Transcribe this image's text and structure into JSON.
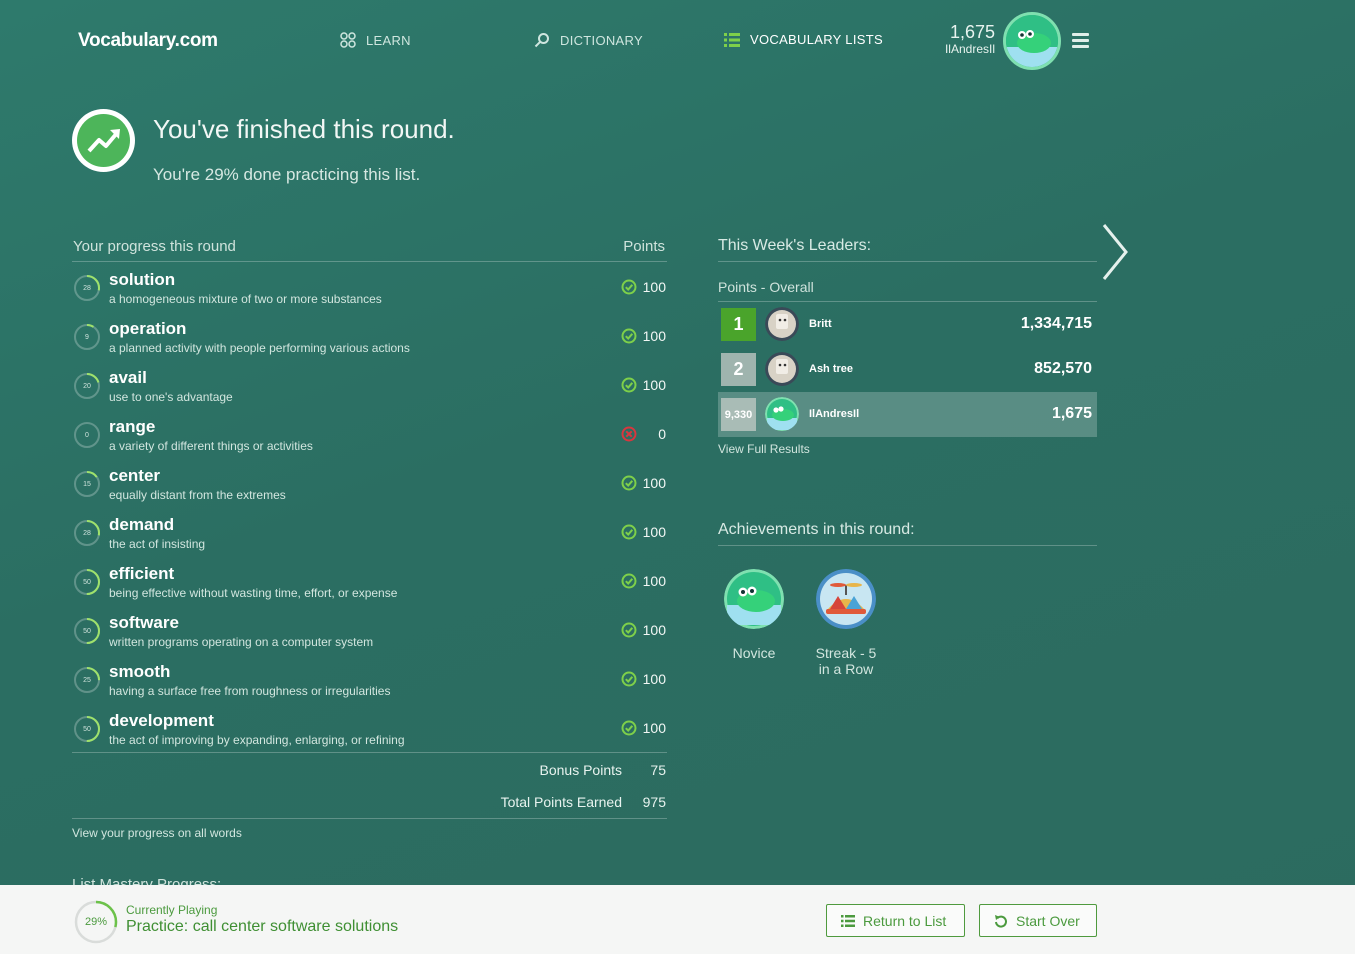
{
  "header": {
    "logo": "Vocabulary.com",
    "nav": [
      {
        "label": "LEARN"
      },
      {
        "label": "DICTIONARY"
      },
      {
        "label": "VOCABULARY LISTS"
      }
    ],
    "user_points": "1,675",
    "username": "IlAndresIl"
  },
  "hero": {
    "title": "You've finished this round.",
    "subtitle": "You're 29% done practicing this list."
  },
  "progress": {
    "heading": "Your progress this round",
    "points_heading": "Points",
    "rows": [
      {
        "ring": "28",
        "word": "solution",
        "def": "a homogeneous mixture of two or more substances",
        "status": "correct",
        "points": "100"
      },
      {
        "ring": "9",
        "word": "operation",
        "def": "a planned activity with people performing various actions",
        "status": "correct",
        "points": "100"
      },
      {
        "ring": "20",
        "word": "avail",
        "def": "use to one's advantage",
        "status": "correct",
        "points": "100"
      },
      {
        "ring": "0",
        "word": "range",
        "def": "a variety of different things or activities",
        "status": "wrong",
        "points": "0"
      },
      {
        "ring": "15",
        "word": "center",
        "def": "equally distant from the extremes",
        "status": "correct",
        "points": "100"
      },
      {
        "ring": "28",
        "word": "demand",
        "def": "the act of insisting",
        "status": "correct",
        "points": "100"
      },
      {
        "ring": "50",
        "word": "efficient",
        "def": "being effective without wasting time, effort, or expense",
        "status": "correct",
        "points": "100"
      },
      {
        "ring": "50",
        "word": "software",
        "def": "written programs operating on a computer system",
        "status": "correct",
        "points": "100"
      },
      {
        "ring": "25",
        "word": "smooth",
        "def": "having a surface free from roughness or irregularities",
        "status": "correct",
        "points": "100"
      },
      {
        "ring": "50",
        "word": "development",
        "def": "the act of improving by expanding, enlarging, or refining",
        "status": "correct",
        "points": "100"
      }
    ],
    "bonus_label": "Bonus Points",
    "bonus_value": "75",
    "total_label": "Total Points Earned",
    "total_value": "975",
    "view_progress": "View your progress on all words",
    "mastery_heading": "List Mastery Progress:"
  },
  "leaders": {
    "title": "This Week's Leaders:",
    "subtitle": "Points - Overall",
    "rows": [
      {
        "rank": "1",
        "name": "Britt",
        "points": "1,334,715"
      },
      {
        "rank": "2",
        "name": "Ash tree",
        "points": "852,570"
      },
      {
        "rank": "9,330",
        "name": "IlAndresIl",
        "points": "1,675"
      }
    ],
    "view_full": "View Full Results"
  },
  "achievements": {
    "title": "Achievements in this round:",
    "badges": [
      {
        "label": "Novice"
      },
      {
        "label": "Streak - 5 in a Row"
      }
    ]
  },
  "bottom": {
    "percent": "29%",
    "percent_value": 0.29,
    "current_label": "Currently Playing",
    "current_title": "Practice: call center software solutions",
    "return_label": "Return to List",
    "start_over_label": "Start Over"
  },
  "colors": {
    "accent_green": "#4b9a3e",
    "correct": "#7ed04a",
    "wrong": "#d9363e"
  }
}
